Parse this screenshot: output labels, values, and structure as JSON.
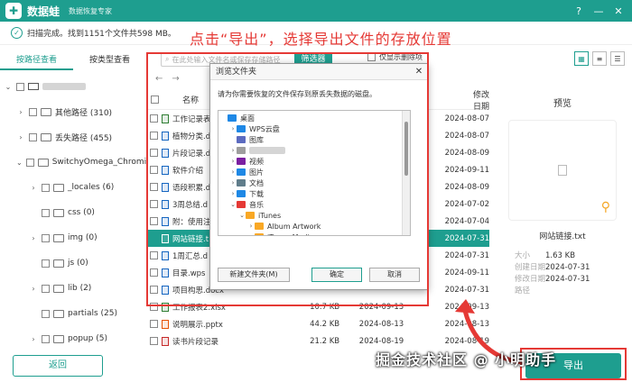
{
  "app": {
    "name": "数据蛙",
    "subtitle": "数据恢复专家"
  },
  "window_buttons": [
    "?",
    "—",
    "✕"
  ],
  "status": {
    "text": "扫描完成。找到1151个文件共598 MB。"
  },
  "annotation": "点击“导出”，选择导出文件的存放位置",
  "side_tabs": [
    "按路径查看",
    "按类型查看"
  ],
  "tree": [
    {
      "label": "",
      "level": 0,
      "expanded": true,
      "drive": true
    },
    {
      "label": "其他路径 (310)",
      "level": 1,
      "expanded": false
    },
    {
      "label": "丢失路径 (455)",
      "level": 1,
      "expanded": false
    },
    {
      "label": "SwitchyOmega_Chromium",
      "level": 1,
      "expanded": true
    },
    {
      "label": "_locales (6)",
      "level": 2,
      "expanded": false
    },
    {
      "label": "css (0)",
      "level": 2,
      "expanded": null
    },
    {
      "label": "img (0)",
      "level": 2,
      "expanded": false
    },
    {
      "label": "js (0)",
      "level": 2,
      "expanded": null
    },
    {
      "label": "lib (2)",
      "level": 2,
      "expanded": false
    },
    {
      "label": "partials (25)",
      "level": 2,
      "expanded": null
    },
    {
      "label": "popup (5)",
      "level": 2,
      "expanded": false
    }
  ],
  "back_button": "返回",
  "search": {
    "placeholder": "在此处输入文件名或保存存储路径"
  },
  "filter_button": "筛选器",
  "show_deleted": "仅显示删除项",
  "columns": {
    "name": "名称",
    "size": "",
    "ctime": "",
    "mtime": "修改日期"
  },
  "files": [
    {
      "name": "工作记录表",
      "size": "",
      "ctime": "",
      "mtime": "2024-08-07",
      "checked": false,
      "selected": false,
      "color": "#2e7d32"
    },
    {
      "name": "植物分类.d",
      "size": "",
      "ctime": "",
      "mtime": "2024-08-07",
      "checked": false,
      "selected": false,
      "color": "#1565c0"
    },
    {
      "name": "片段记录.d",
      "size": "",
      "ctime": "",
      "mtime": "2024-08-09",
      "checked": false,
      "selected": false,
      "color": "#1565c0"
    },
    {
      "name": "软件介绍",
      "size": "",
      "ctime": "",
      "mtime": "2024-09-11",
      "checked": false,
      "selected": false,
      "color": "#1565c0"
    },
    {
      "name": "语段积累.d",
      "size": "",
      "ctime": "",
      "mtime": "2024-08-09",
      "checked": false,
      "selected": false,
      "color": "#1565c0"
    },
    {
      "name": "3周总结.d",
      "size": "",
      "ctime": "",
      "mtime": "2024-07-02",
      "checked": false,
      "selected": false,
      "color": "#1565c0"
    },
    {
      "name": "附：使用注",
      "size": "",
      "ctime": "",
      "mtime": "2024-07-04",
      "checked": false,
      "selected": false,
      "color": "#1565c0"
    },
    {
      "name": "网站链接.t",
      "size": "",
      "ctime": "",
      "mtime": "2024-07-31",
      "checked": true,
      "selected": true,
      "color": "#ffffff"
    },
    {
      "name": "1周汇总.d",
      "size": "",
      "ctime": "",
      "mtime": "2024-07-31",
      "checked": false,
      "selected": false,
      "color": "#1565c0"
    },
    {
      "name": "目录.wps",
      "size": "",
      "ctime": "",
      "mtime": "2024-09-11",
      "checked": false,
      "selected": false,
      "color": "#1565c0"
    },
    {
      "name": "项目构思.docx",
      "size": "",
      "ctime": "",
      "mtime": "2024-07-31",
      "checked": false,
      "selected": false,
      "color": "#1565c0"
    },
    {
      "name": "工作报表2.xlsx",
      "size": "10.7 KB",
      "ctime": "2024-09-13",
      "mtime": "2024-09-13",
      "checked": false,
      "selected": false,
      "color": "#2e7d32"
    },
    {
      "name": "说明展示.pptx",
      "size": "44.2 KB",
      "ctime": "2024-08-13",
      "mtime": "2024-08-13",
      "checked": false,
      "selected": false,
      "color": "#e65100"
    },
    {
      "name": "读书片段记录",
      "size": "21.2 KB",
      "ctime": "2024-08-19",
      "mtime": "2024-08-19",
      "checked": false,
      "selected": false,
      "color": "#c62828"
    }
  ],
  "preview": {
    "title": "预览",
    "filename": "网站链接.txt",
    "meta": [
      {
        "key": "大小",
        "value": "1.63 KB"
      },
      {
        "key": "创建日期",
        "value": "2024-07-31"
      },
      {
        "key": "修改日期",
        "value": "2024-07-31"
      },
      {
        "key": "路径",
        "value": ""
      }
    ]
  },
  "recover_button": "导出",
  "dialog": {
    "title": "浏览文件夹",
    "message": "请为你需要恢复的文件保存到原丢失数据的磁盘。",
    "tree": [
      {
        "label": "桌面",
        "level": 0,
        "chev": "",
        "color": "#1e88e5"
      },
      {
        "label": "WPS云盘",
        "level": 1,
        "chev": "›",
        "color": "#1e88e5"
      },
      {
        "label": "图库",
        "level": 1,
        "chev": "",
        "color": "#5c6bc0"
      },
      {
        "label": "",
        "level": 1,
        "chev": "›",
        "color": "#9e9e9e"
      },
      {
        "label": "视频",
        "level": 1,
        "chev": "›",
        "color": "#7b1fa2"
      },
      {
        "label": "图片",
        "level": 1,
        "chev": "›",
        "color": "#1e88e5"
      },
      {
        "label": "文档",
        "level": 1,
        "chev": "›",
        "color": "#607d8b"
      },
      {
        "label": "下载",
        "level": 1,
        "chev": "›",
        "color": "#1e88e5"
      },
      {
        "label": "音乐",
        "level": 1,
        "chev": "⌄",
        "color": "#e53935"
      },
      {
        "label": "iTunes",
        "level": 2,
        "chev": "⌄",
        "color": "#f9a825"
      },
      {
        "label": "Album Artwork",
        "level": 3,
        "chev": "›",
        "color": "#f9a825"
      },
      {
        "label": "iTunes Media",
        "level": 3,
        "chev": "›",
        "color": "#f9a825"
      }
    ],
    "new_folder": "新建文件夹(M)",
    "ok": "确定",
    "cancel": "取消"
  },
  "watermark": "掘金技术社区 @ 小明助手"
}
